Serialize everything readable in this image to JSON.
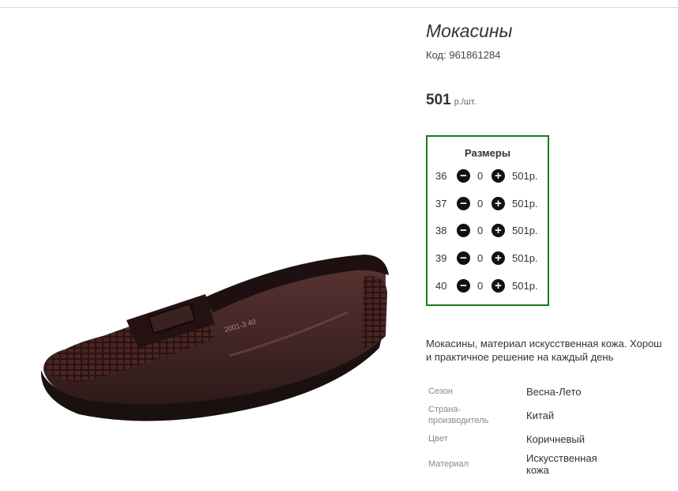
{
  "product": {
    "title": "Мокасины",
    "code_label": "Код:",
    "code": "961861284",
    "price": "501",
    "price_unit": "р./шт."
  },
  "sizes": {
    "title": "Размеры",
    "rows": [
      {
        "size": "36",
        "qty": "0",
        "price": "501р."
      },
      {
        "size": "37",
        "qty": "0",
        "price": "501р."
      },
      {
        "size": "38",
        "qty": "0",
        "price": "501р."
      },
      {
        "size": "39",
        "qty": "0",
        "price": "501р."
      },
      {
        "size": "40",
        "qty": "0",
        "price": "501р."
      }
    ],
    "minus_icon": "minus-circle-icon",
    "plus_icon": "plus-circle-icon",
    "border_color": "#1a7a1a"
  },
  "description": {
    "line1": "Мокасины, материал искусственная кожа. Хорош",
    "line2": "и практичное решение на каждый день"
  },
  "attributes": {
    "season": {
      "label": "Сезон",
      "value": "Весна-Лето"
    },
    "country": {
      "label_line1": "Страна-",
      "label_line2": "производитель",
      "value": "Китай"
    },
    "color": {
      "label": "Цвет",
      "value": "Коричневый"
    },
    "material": {
      "label": "Материал",
      "value_line1": "Искусственная",
      "value_line2": "кожа"
    }
  }
}
